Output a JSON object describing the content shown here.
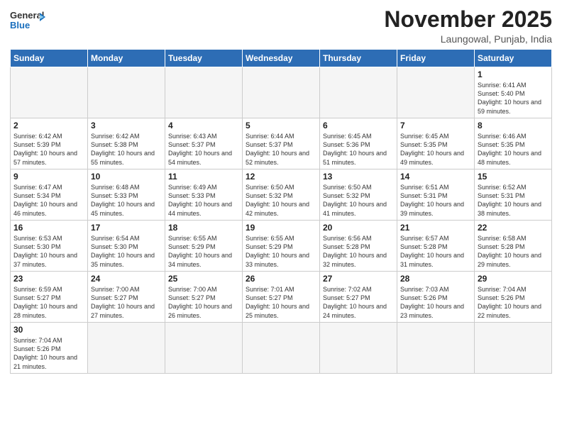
{
  "logo": {
    "general": "General",
    "blue": "Blue"
  },
  "header": {
    "title": "November 2025",
    "location": "Laungowal, Punjab, India"
  },
  "weekdays": [
    "Sunday",
    "Monday",
    "Tuesday",
    "Wednesday",
    "Thursday",
    "Friday",
    "Saturday"
  ],
  "weeks": [
    [
      {
        "day": "",
        "info": ""
      },
      {
        "day": "",
        "info": ""
      },
      {
        "day": "",
        "info": ""
      },
      {
        "day": "",
        "info": ""
      },
      {
        "day": "",
        "info": ""
      },
      {
        "day": "",
        "info": ""
      },
      {
        "day": "1",
        "info": "Sunrise: 6:41 AM\nSunset: 5:40 PM\nDaylight: 10 hours\nand 59 minutes."
      }
    ],
    [
      {
        "day": "2",
        "info": "Sunrise: 6:42 AM\nSunset: 5:39 PM\nDaylight: 10 hours\nand 57 minutes."
      },
      {
        "day": "3",
        "info": "Sunrise: 6:42 AM\nSunset: 5:38 PM\nDaylight: 10 hours\nand 55 minutes."
      },
      {
        "day": "4",
        "info": "Sunrise: 6:43 AM\nSunset: 5:37 PM\nDaylight: 10 hours\nand 54 minutes."
      },
      {
        "day": "5",
        "info": "Sunrise: 6:44 AM\nSunset: 5:37 PM\nDaylight: 10 hours\nand 52 minutes."
      },
      {
        "day": "6",
        "info": "Sunrise: 6:45 AM\nSunset: 5:36 PM\nDaylight: 10 hours\nand 51 minutes."
      },
      {
        "day": "7",
        "info": "Sunrise: 6:45 AM\nSunset: 5:35 PM\nDaylight: 10 hours\nand 49 minutes."
      },
      {
        "day": "8",
        "info": "Sunrise: 6:46 AM\nSunset: 5:35 PM\nDaylight: 10 hours\nand 48 minutes."
      }
    ],
    [
      {
        "day": "9",
        "info": "Sunrise: 6:47 AM\nSunset: 5:34 PM\nDaylight: 10 hours\nand 46 minutes."
      },
      {
        "day": "10",
        "info": "Sunrise: 6:48 AM\nSunset: 5:33 PM\nDaylight: 10 hours\nand 45 minutes."
      },
      {
        "day": "11",
        "info": "Sunrise: 6:49 AM\nSunset: 5:33 PM\nDaylight: 10 hours\nand 44 minutes."
      },
      {
        "day": "12",
        "info": "Sunrise: 6:50 AM\nSunset: 5:32 PM\nDaylight: 10 hours\nand 42 minutes."
      },
      {
        "day": "13",
        "info": "Sunrise: 6:50 AM\nSunset: 5:32 PM\nDaylight: 10 hours\nand 41 minutes."
      },
      {
        "day": "14",
        "info": "Sunrise: 6:51 AM\nSunset: 5:31 PM\nDaylight: 10 hours\nand 39 minutes."
      },
      {
        "day": "15",
        "info": "Sunrise: 6:52 AM\nSunset: 5:31 PM\nDaylight: 10 hours\nand 38 minutes."
      }
    ],
    [
      {
        "day": "16",
        "info": "Sunrise: 6:53 AM\nSunset: 5:30 PM\nDaylight: 10 hours\nand 37 minutes."
      },
      {
        "day": "17",
        "info": "Sunrise: 6:54 AM\nSunset: 5:30 PM\nDaylight: 10 hours\nand 35 minutes."
      },
      {
        "day": "18",
        "info": "Sunrise: 6:55 AM\nSunset: 5:29 PM\nDaylight: 10 hours\nand 34 minutes."
      },
      {
        "day": "19",
        "info": "Sunrise: 6:55 AM\nSunset: 5:29 PM\nDaylight: 10 hours\nand 33 minutes."
      },
      {
        "day": "20",
        "info": "Sunrise: 6:56 AM\nSunset: 5:28 PM\nDaylight: 10 hours\nand 32 minutes."
      },
      {
        "day": "21",
        "info": "Sunrise: 6:57 AM\nSunset: 5:28 PM\nDaylight: 10 hours\nand 31 minutes."
      },
      {
        "day": "22",
        "info": "Sunrise: 6:58 AM\nSunset: 5:28 PM\nDaylight: 10 hours\nand 29 minutes."
      }
    ],
    [
      {
        "day": "23",
        "info": "Sunrise: 6:59 AM\nSunset: 5:27 PM\nDaylight: 10 hours\nand 28 minutes."
      },
      {
        "day": "24",
        "info": "Sunrise: 7:00 AM\nSunset: 5:27 PM\nDaylight: 10 hours\nand 27 minutes."
      },
      {
        "day": "25",
        "info": "Sunrise: 7:00 AM\nSunset: 5:27 PM\nDaylight: 10 hours\nand 26 minutes."
      },
      {
        "day": "26",
        "info": "Sunrise: 7:01 AM\nSunset: 5:27 PM\nDaylight: 10 hours\nand 25 minutes."
      },
      {
        "day": "27",
        "info": "Sunrise: 7:02 AM\nSunset: 5:27 PM\nDaylight: 10 hours\nand 24 minutes."
      },
      {
        "day": "28",
        "info": "Sunrise: 7:03 AM\nSunset: 5:26 PM\nDaylight: 10 hours\nand 23 minutes."
      },
      {
        "day": "29",
        "info": "Sunrise: 7:04 AM\nSunset: 5:26 PM\nDaylight: 10 hours\nand 22 minutes."
      }
    ],
    [
      {
        "day": "30",
        "info": "Sunrise: 7:04 AM\nSunset: 5:26 PM\nDaylight: 10 hours\nand 21 minutes."
      },
      {
        "day": "",
        "info": ""
      },
      {
        "day": "",
        "info": ""
      },
      {
        "day": "",
        "info": ""
      },
      {
        "day": "",
        "info": ""
      },
      {
        "day": "",
        "info": ""
      },
      {
        "day": "",
        "info": ""
      }
    ]
  ]
}
